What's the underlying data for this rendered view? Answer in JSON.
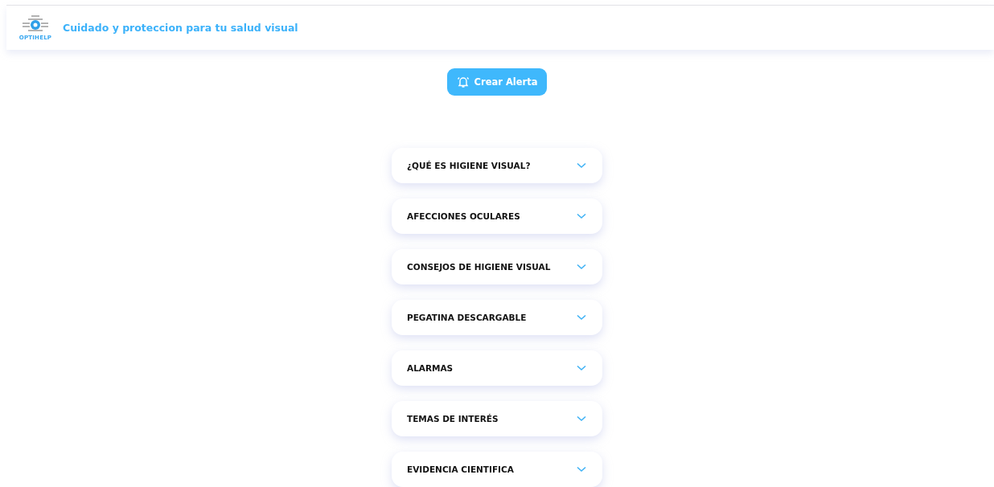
{
  "header": {
    "logo_text": "OPTIHELP",
    "title": "Cuidado y proteccion para tu salud visual"
  },
  "alert_button": {
    "label": "Crear Alerta"
  },
  "sections": [
    {
      "label": "¿QUÉ ES HIGIENE VISUAL?",
      "expanded": false
    },
    {
      "label": "AFECCIONES OCULARES",
      "expanded": false
    },
    {
      "label": "CONSEJOS DE HIGIENE VISUAL",
      "expanded": false
    },
    {
      "label": "PEGATINA DESCARGABLE",
      "expanded": false
    },
    {
      "label": "ALARMAS",
      "expanded": false
    },
    {
      "label": "TEMAS DE INTERÉS",
      "expanded": false
    },
    {
      "label": "EVIDENCIA CIENTIFICA",
      "expanded": false
    }
  ]
}
